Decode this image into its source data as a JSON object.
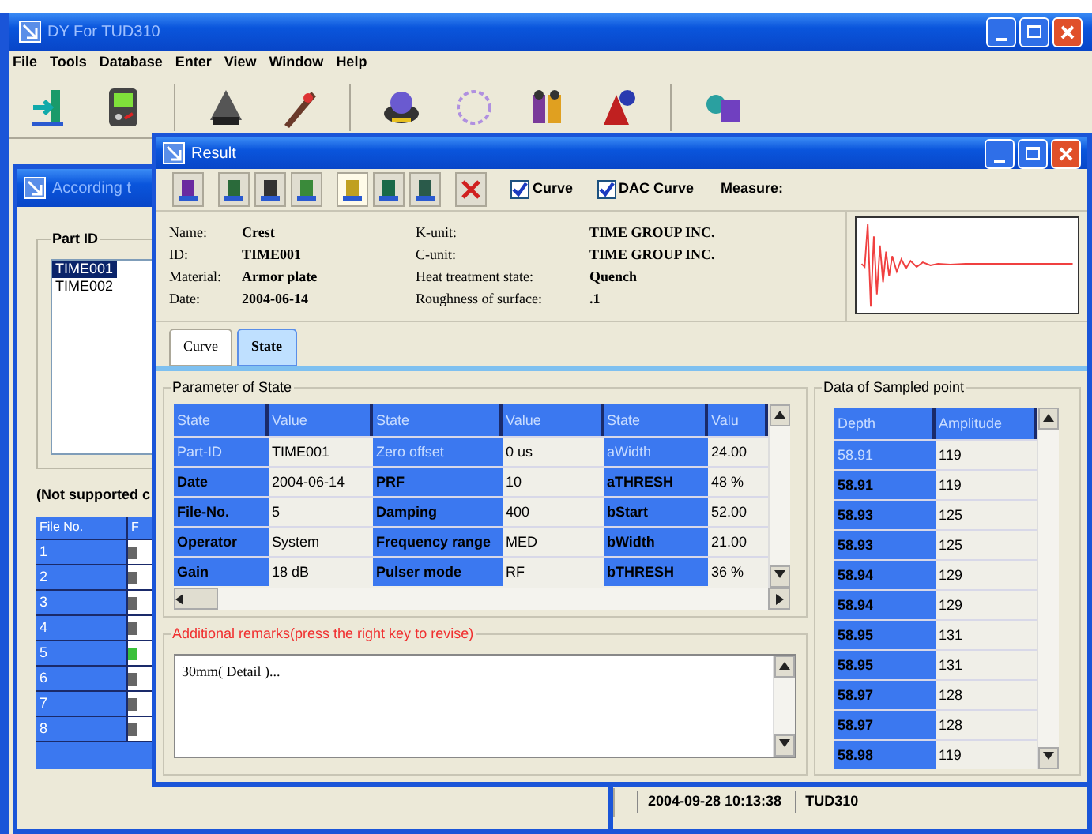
{
  "main_window": {
    "title": "DY For TUD310",
    "menu": [
      "File",
      "Tools",
      "Database",
      "Enter",
      "View",
      "Window",
      "Help"
    ]
  },
  "part_window": {
    "title": "According t",
    "part_id_group": "Part ID",
    "part_ids": [
      {
        "label": "TIME001",
        "selected": true
      },
      {
        "label": "TIME002",
        "selected": false
      }
    ],
    "note": "(Not supported c",
    "file_columns": [
      "File No.",
      "F"
    ],
    "file_rows": [
      {
        "no": "1",
        "selected": false
      },
      {
        "no": "2",
        "selected": false
      },
      {
        "no": "3",
        "selected": false
      },
      {
        "no": "4",
        "selected": false
      },
      {
        "no": "5",
        "selected": true
      },
      {
        "no": "6",
        "selected": false
      },
      {
        "no": "7",
        "selected": false
      },
      {
        "no": "8",
        "selected": false
      }
    ]
  },
  "result_window": {
    "title": "Result",
    "checkboxes": [
      {
        "label": "Curve",
        "checked": true
      },
      {
        "label": "DAC Curve",
        "checked": true
      }
    ],
    "measure_label": "Measure:",
    "info": [
      {
        "label": "Name:",
        "value": "Crest"
      },
      {
        "label": "ID:",
        "value": "TIME001"
      },
      {
        "label": "Material:",
        "value": "Armor plate"
      },
      {
        "label": "Date:",
        "value": "2004-06-14"
      },
      {
        "label": "K-unit:",
        "value": "TIME GROUP INC."
      },
      {
        "label": "C-unit:",
        "value": "TIME GROUP INC."
      },
      {
        "label": "Heat treatment state:",
        "value": "Quench"
      },
      {
        "label": "Roughness of surface:",
        "value": ".1"
      }
    ],
    "tabs": [
      {
        "label": "Curve",
        "selected": false
      },
      {
        "label": "State",
        "selected": true
      }
    ],
    "state_group": {
      "title": "Parameter of State",
      "columns": [
        "State",
        "Value",
        "State",
        "Value",
        "State",
        "Valu"
      ],
      "rows": [
        {
          "cells": [
            "Part-ID",
            "TIME001",
            "Zero offset",
            "0 us",
            "aWidth",
            "24.00"
          ],
          "selected": true
        },
        {
          "cells": [
            "Date",
            "2004-06-14",
            "PRF",
            "10",
            "aTHRESH",
            "48 %"
          ],
          "selected": false
        },
        {
          "cells": [
            "File-No.",
            "5",
            "Damping",
            "400",
            "bStart",
            "52.00"
          ],
          "selected": false
        },
        {
          "cells": [
            "Operator",
            "System",
            "Frequency range",
            "MED",
            "bWidth",
            "21.00"
          ],
          "selected": false
        },
        {
          "cells": [
            "Gain",
            "18 dB",
            "Pulser mode",
            "RF",
            "bTHRESH",
            "36 %"
          ],
          "selected": false
        }
      ]
    },
    "remarks": {
      "title": "Additional remarks(press the right key to revise)",
      "text": "30mm( Detail )..."
    },
    "sampled": {
      "title": "Data of Sampled point",
      "columns": [
        "Depth",
        "Amplitude"
      ],
      "rows": [
        {
          "cells": [
            "58.91",
            "119"
          ],
          "selected": true
        },
        {
          "cells": [
            "58.91",
            "119"
          ],
          "selected": false
        },
        {
          "cells": [
            "58.93",
            "125"
          ],
          "selected": false
        },
        {
          "cells": [
            "58.93",
            "125"
          ],
          "selected": false
        },
        {
          "cells": [
            "58.94",
            "129"
          ],
          "selected": false
        },
        {
          "cells": [
            "58.94",
            "129"
          ],
          "selected": false
        },
        {
          "cells": [
            "58.95",
            "131"
          ],
          "selected": false
        },
        {
          "cells": [
            "58.95",
            "131"
          ],
          "selected": false
        },
        {
          "cells": [
            "58.97",
            "128"
          ],
          "selected": false
        },
        {
          "cells": [
            "58.97",
            "128"
          ],
          "selected": false
        },
        {
          "cells": [
            "58.98",
            "119"
          ],
          "selected": false
        }
      ]
    }
  },
  "status_window": {
    "fields": [
      "2004-09-28 10:13:38",
      "TUD310"
    ]
  }
}
